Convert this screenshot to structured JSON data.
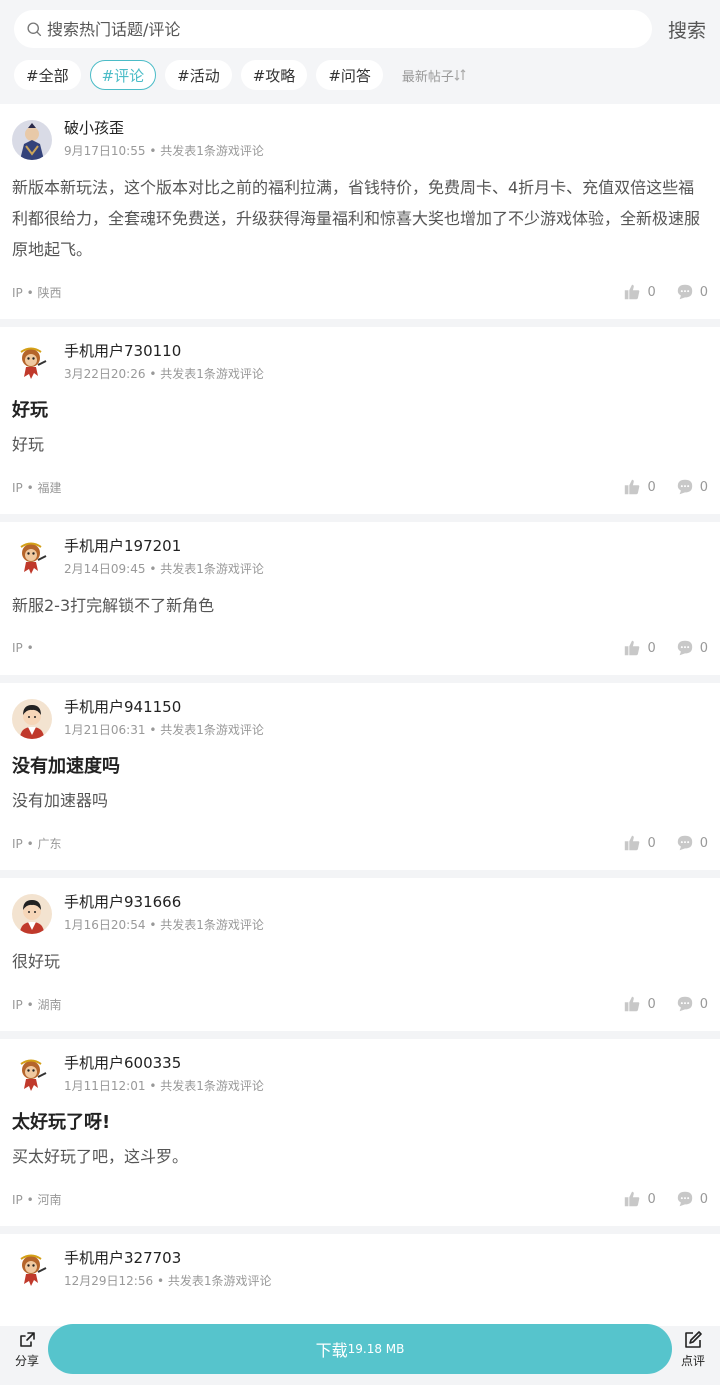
{
  "search": {
    "placeholder": "搜索热门话题/评论",
    "button": "搜索"
  },
  "tabs": [
    {
      "label": "#全部"
    },
    {
      "label": "#评论"
    },
    {
      "label": "#活动"
    },
    {
      "label": "#攻略"
    },
    {
      "label": "#问答"
    }
  ],
  "active_tab": "#评论",
  "sort_label": "最新帖子",
  "accent_color": "#4bbcc7",
  "posts": [
    {
      "user": "破小孩歪",
      "avatar": "monk-avatar",
      "date": "9月17日10:55",
      "meta_suffix": "共发表1条游戏评论",
      "title": "",
      "content": "新版本新玩法，这个版本对比之前的福利拉满，省钱特价，免费周卡、4折月卡、充值双倍这些福利都很给力，全套魂环免费送，升级获得海量福利和惊喜大奖也增加了不少游戏体验，全新极速服原地起飞。",
      "ip": "IP • 陕西",
      "likes": "0",
      "comments": "0"
    },
    {
      "user": "手机用户730110",
      "avatar": "monkey-avatar",
      "date": "3月22日20:26",
      "meta_suffix": "共发表1条游戏评论",
      "title": "好玩",
      "content": "好玩",
      "ip": "IP • 福建",
      "likes": "0",
      "comments": "0"
    },
    {
      "user": "手机用户197201",
      "avatar": "monkey-avatar",
      "date": "2月14日09:45",
      "meta_suffix": "共发表1条游戏评论",
      "title": "",
      "content": "新服2-3打完解锁不了新角色",
      "ip": "IP •",
      "likes": "0",
      "comments": "0"
    },
    {
      "user": "手机用户941150",
      "avatar": "boy-avatar",
      "date": "1月21日06:31",
      "meta_suffix": "共发表1条游戏评论",
      "title": "没有加速度吗",
      "content": "没有加速器吗",
      "ip": "IP • 广东",
      "likes": "0",
      "comments": "0"
    },
    {
      "user": "手机用户931666",
      "avatar": "boy-avatar",
      "date": "1月16日20:54",
      "meta_suffix": "共发表1条游戏评论",
      "title": "",
      "content": "很好玩",
      "ip": "IP • 湖南",
      "likes": "0",
      "comments": "0"
    },
    {
      "user": "手机用户600335",
      "avatar": "monkey-avatar",
      "date": "1月11日12:01",
      "meta_suffix": "共发表1条游戏评论",
      "title": "太好玩了呀!",
      "content": "买太好玩了吧，这斗罗。",
      "ip": "IP • 河南",
      "likes": "0",
      "comments": "0"
    },
    {
      "user": "手机用户327703",
      "avatar": "monkey-avatar",
      "date": "12月29日12:56",
      "meta_suffix": "共发表1条游戏评论",
      "title": "",
      "content": "",
      "ip": "",
      "likes": "",
      "comments": ""
    }
  ],
  "bottom": {
    "share_label": "分享",
    "download_label": "下载",
    "download_size": "19.18 MB",
    "review_label": "点评",
    "download_color": "#56c4cc"
  }
}
